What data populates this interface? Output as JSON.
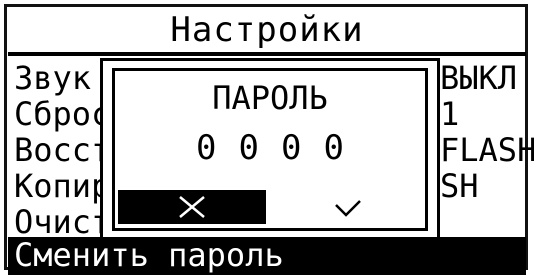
{
  "header": {
    "title": "Настройки"
  },
  "menu": {
    "items": [
      {
        "label": "Звук",
        "value": "ВЫКЛ"
      },
      {
        "label": "Сброс",
        "value": "1"
      },
      {
        "label": "Восстановить",
        "value": "FLASH"
      },
      {
        "label": "Копировать",
        "value": "SH"
      },
      {
        "label": "Очистить",
        "value": ""
      },
      {
        "label": "Сменить пароль",
        "value": ""
      }
    ],
    "selected_index": 5
  },
  "dialog": {
    "title": "ПАРОЛЬ",
    "digits": [
      "0",
      "0",
      "0",
      "0"
    ],
    "cancel_icon": "close-icon",
    "ok_icon": "check-icon"
  }
}
